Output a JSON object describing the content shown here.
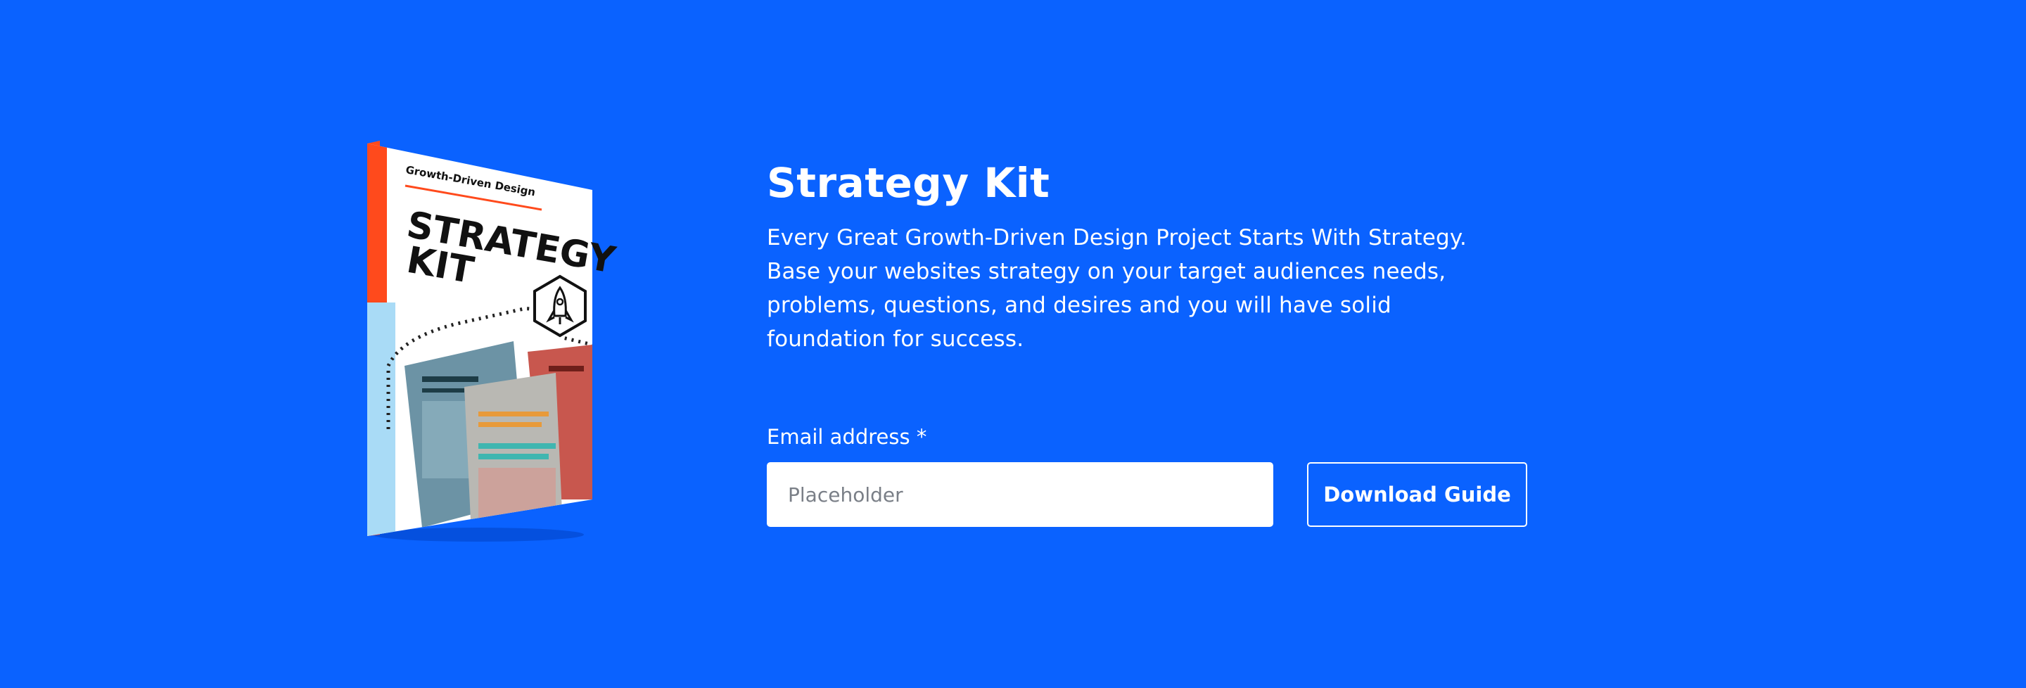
{
  "colors": {
    "background": "#0a62ff",
    "accent_orange": "#ff4a1c",
    "text": "#ffffff"
  },
  "book": {
    "brand": "Growth-Driven Design",
    "title_line1": "STRATEGY",
    "title_line2": "KIT",
    "icon": "rocket-icon"
  },
  "hero": {
    "title": "Strategy Kit",
    "description": "Every Great Growth-Driven Design Project Starts With Strategy. Base your websites strategy on your target audiences needs, problems, questions, and desires and you will have solid foundation for success."
  },
  "form": {
    "email_label": "Email address *",
    "email_placeholder": "Placeholder",
    "email_value": "",
    "submit_label": "Download Guide"
  }
}
